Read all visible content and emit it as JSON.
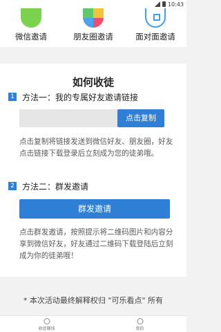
{
  "status": {
    "time": "10:43"
  },
  "share": {
    "items": [
      {
        "label": "微信邀请",
        "icon": "wechat-icon"
      },
      {
        "label": "朋友圈邀请",
        "icon": "moments-icon"
      },
      {
        "label": "面对面邀请",
        "icon": "qr-code-icon"
      }
    ]
  },
  "howto": {
    "title": "如何收徒",
    "method1": {
      "number": "1",
      "title": "方法一：我的专属好友邀请链接",
      "copy_button": "点击复制",
      "description": "点击复制将链接发送到微信好友、朋友圈，好友点击链接下载登录后立刻成为您的徒弟哦。"
    },
    "method2": {
      "number": "2",
      "title": "方法二：群发邀请",
      "button": "群发邀请",
      "description": "点击群发邀请，按照提示将二维码图片和内容分享到微信好友，好友通过二维码下载登陆后立刻成为你的徒弟哦！"
    }
  },
  "footer_note": "* 本次活动最终解释权归 \"可乐看点\" 所有",
  "tabbar": {
    "tabs": [
      {
        "label": "收徒赚钱",
        "icon": "target-icon"
      },
      {
        "label": "我的",
        "icon": "user-icon"
      }
    ]
  },
  "colors": {
    "accent": "#2f7fd6",
    "wechat": "#7bd24e"
  }
}
